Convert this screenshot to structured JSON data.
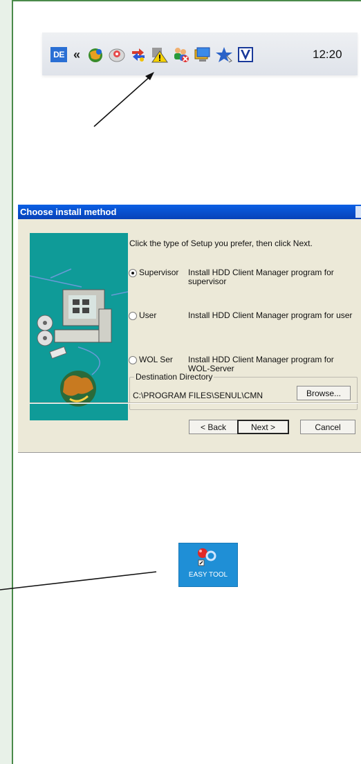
{
  "tray": {
    "language_badge": "DE",
    "chevron": "«",
    "clock": "12:20",
    "icons": [
      "network-globe-icon",
      "cd-drive-icon",
      "sync-arrows-icon",
      "warning-icon",
      "users-icon",
      "monitor-icon",
      "star-icon",
      "v-app-icon"
    ]
  },
  "dialog": {
    "title": "Choose install method",
    "instruction": "Click the type of Setup you prefer, then click Next.",
    "options": [
      {
        "label": "Supervisor",
        "description_line1": "Install HDD Client Manager program for",
        "description_line2": "supervisor",
        "selected": true
      },
      {
        "label": "User",
        "description_line1": "Install HDD Client Manager program for user",
        "description_line2": "",
        "selected": false
      },
      {
        "label": "WOL Ser",
        "description_line1": "Install HDD Client Manager program for",
        "description_line2": "WOL-Server",
        "selected": false
      }
    ],
    "destination_label": "Destination Directory",
    "destination_path": "C:\\PROGRAM FILES\\SENUL\\CMN",
    "browse_button": "Browse...",
    "back_button": "< Back",
    "next_button": "Next >",
    "cancel_button": "Cancel"
  },
  "shortcut": {
    "label": "EASY TOOL"
  },
  "colors": {
    "title_bar": "#0842b8",
    "dialog_bg": "#ece9d8",
    "art_bg": "#0f9b98",
    "shortcut_bg": "#1f8fd6",
    "side_bar": "#e8f1e8"
  }
}
